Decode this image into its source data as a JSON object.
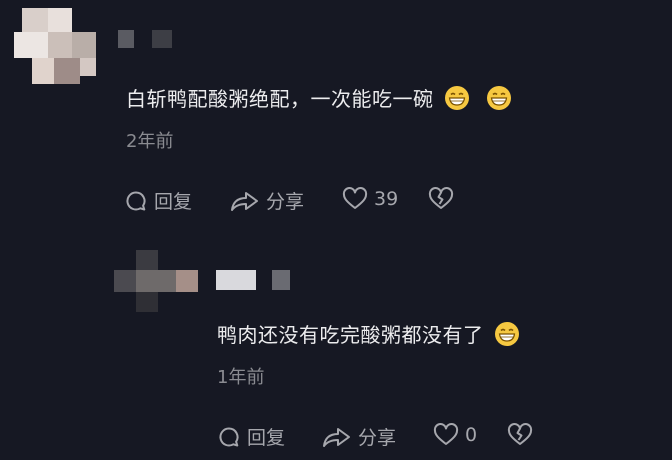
{
  "comments": [
    {
      "text": "白斩鸭配酸粥绝配，一次能吃一碗",
      "emojis": [
        "grinning-face",
        "grinning-face"
      ],
      "time": "2年前",
      "actions": {
        "reply": "回复",
        "share": "分享",
        "like_count": "39"
      },
      "reply": {
        "text": "鸭肉还没有吃完酸粥都没有了",
        "emojis": [
          "grinning-face"
        ],
        "time": "1年前",
        "actions": {
          "reply": "回复",
          "share": "分享",
          "like_count": "0"
        }
      }
    }
  ],
  "colors": {
    "background": "#161823",
    "text": "#ececee",
    "meta": "#8a8b91",
    "emoji_face": "#f6c841"
  }
}
